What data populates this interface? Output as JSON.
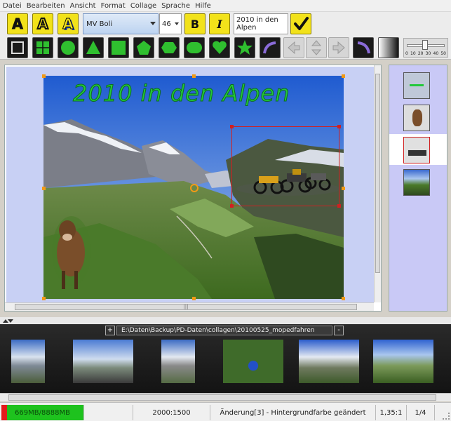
{
  "menu": [
    "Datei",
    "Bearbeiten",
    "Ansicht",
    "Format",
    "Collage",
    "Sprache",
    "Hilfe"
  ],
  "toolbar": {
    "text_styles": [
      "A",
      "A",
      "A"
    ],
    "font_name": "MV Boli",
    "font_size": "46",
    "bold_label": "B",
    "italic_label": "I",
    "text_value": "2010 in den Alpen",
    "slider_ticks": [
      "0",
      "10",
      "20",
      "30",
      "40",
      "50"
    ],
    "slider_value": 0.45
  },
  "canvas": {
    "title_text": "2010 in den Alpen",
    "title_color": "#23c83a"
  },
  "filmstrip": {
    "path": "E:\\Daten\\Backup\\PD-Daten\\collagen\\20100525_mopedfahren",
    "add_label": "+",
    "remove_label": "-"
  },
  "status": {
    "memory": "669MB/8888MB",
    "dimensions": "2000:1500",
    "message": "Änderung[3] - Hintergrundfarbe geändert",
    "ratio": "1,35:1",
    "page": "1/4"
  },
  "colors": {
    "accent_yellow": "#f2e21a",
    "canvas_bg": "#c8d0f4",
    "selection_orange": "#f29a16",
    "selection_red": "#d02020"
  }
}
